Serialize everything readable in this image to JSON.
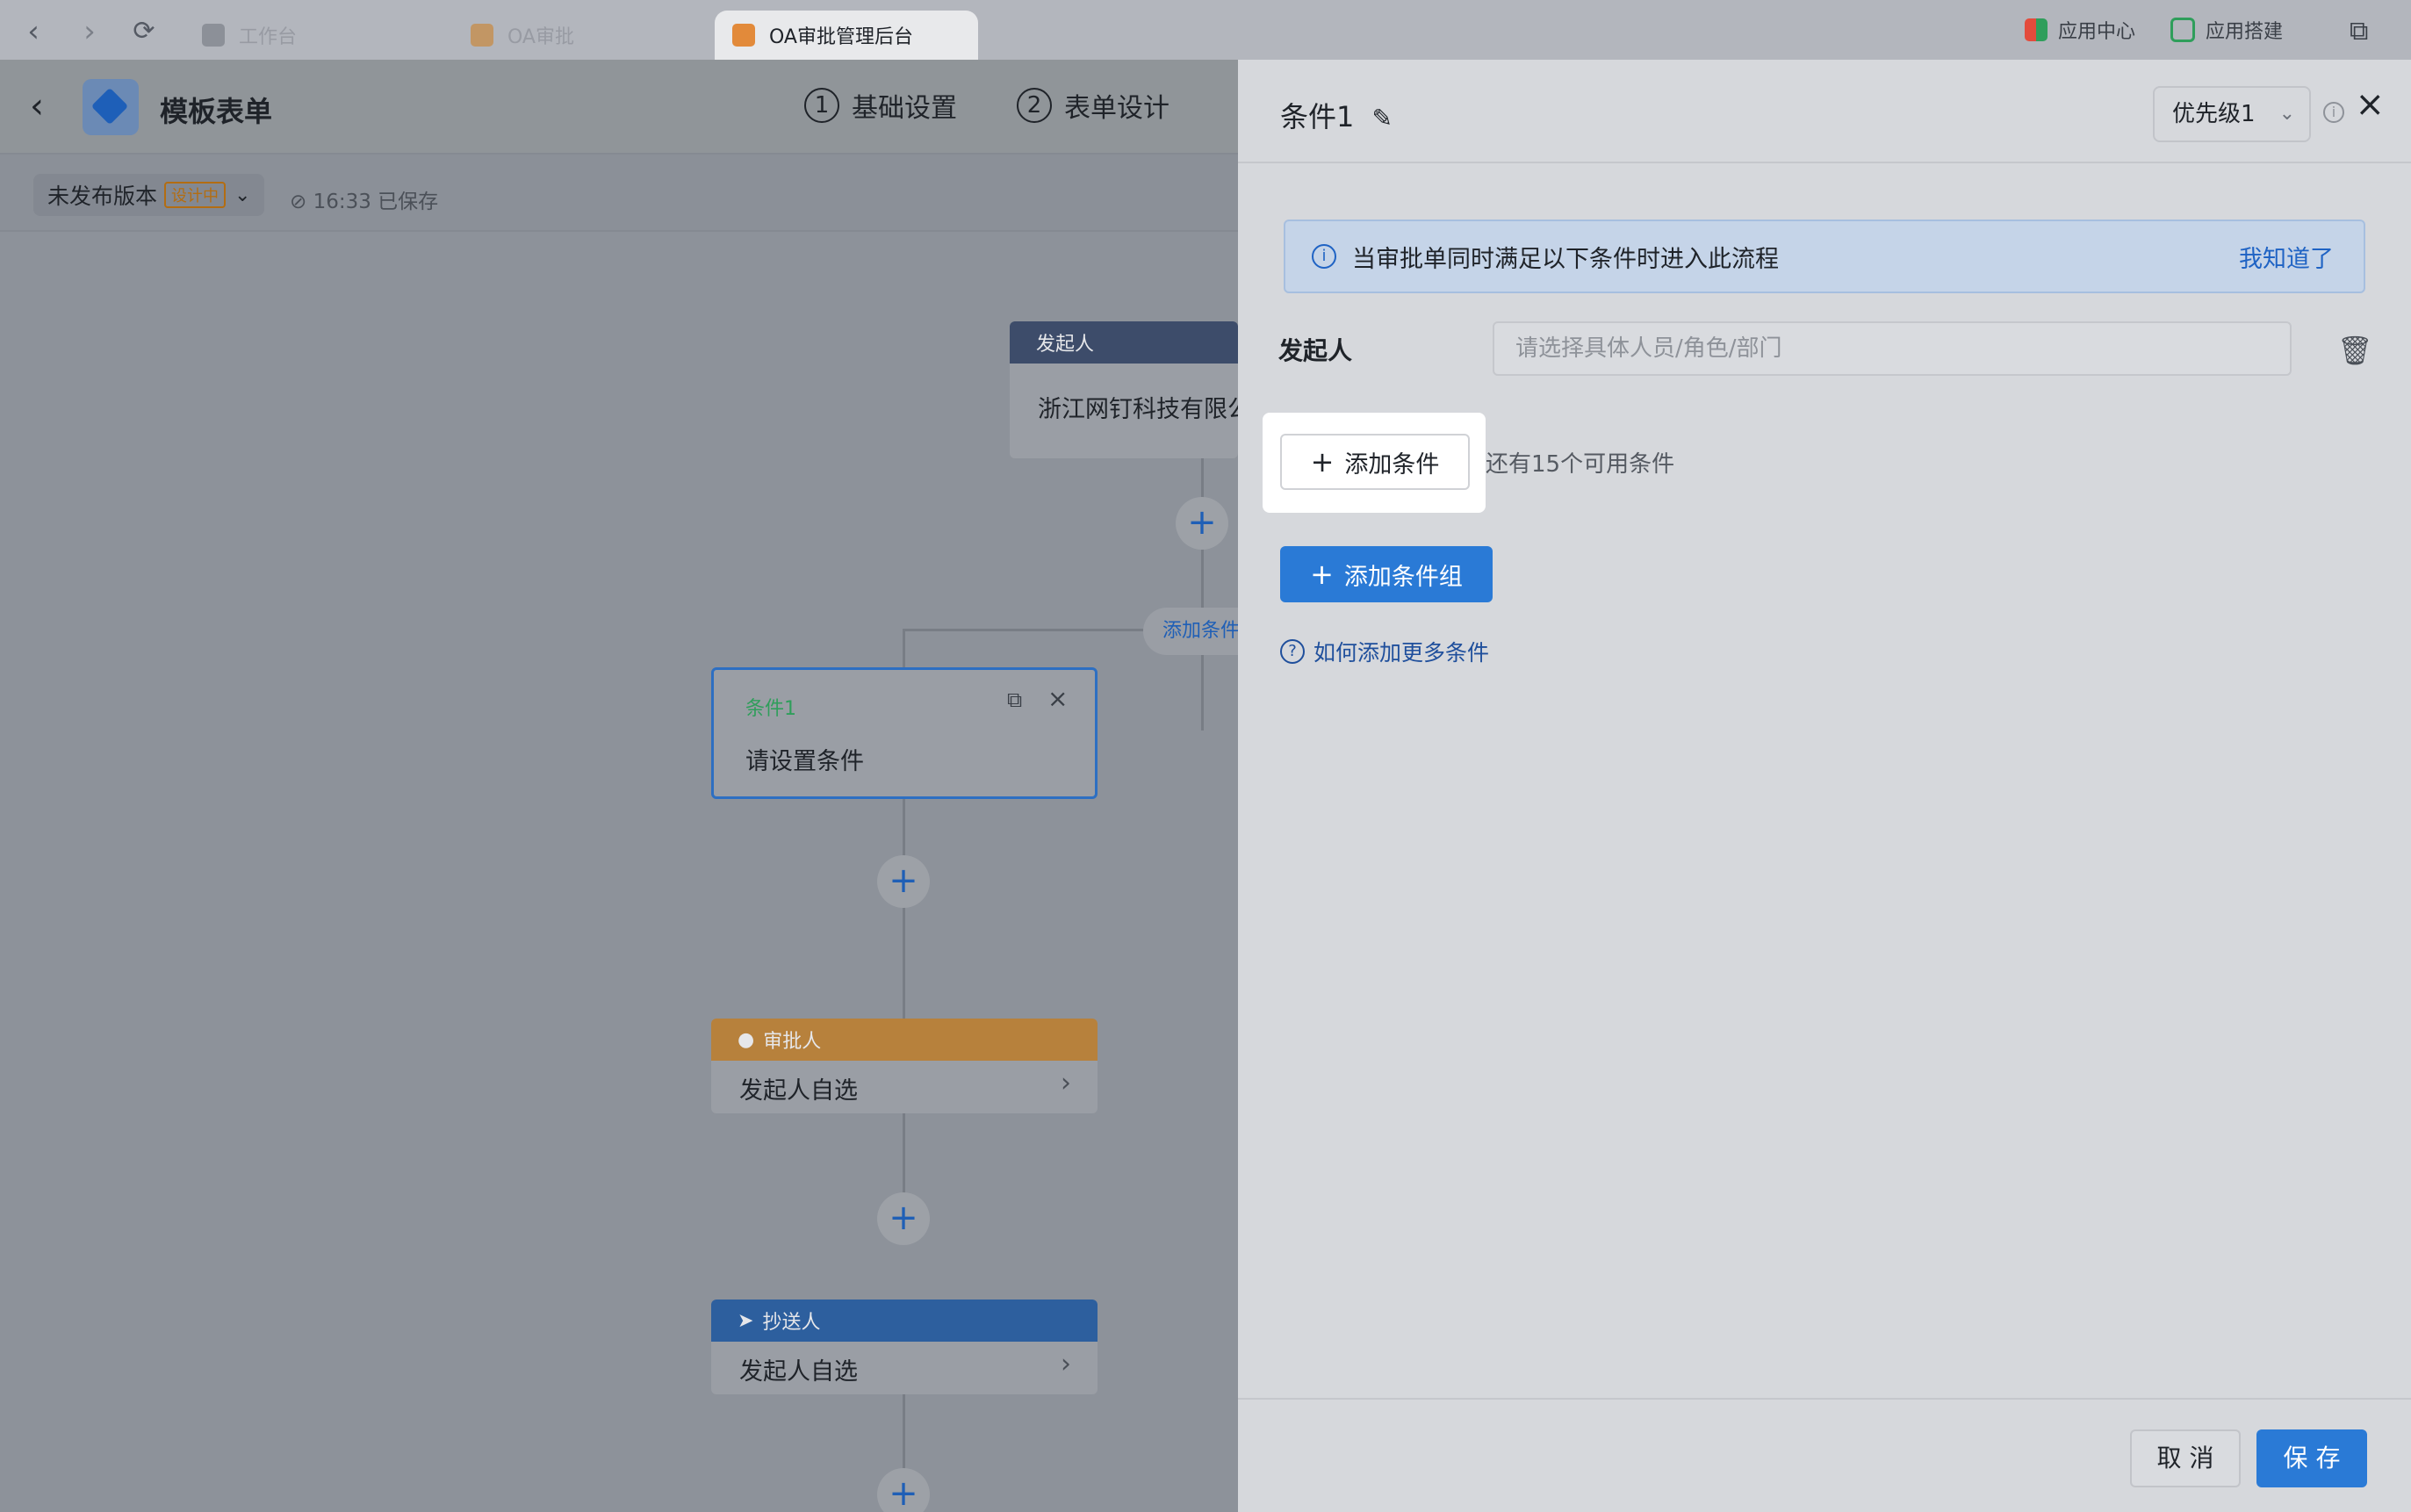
{
  "browser": {
    "tabs": [
      {
        "label": "工作台",
        "active": false
      },
      {
        "label": "OA审批",
        "active": false
      },
      {
        "label": "OA审批管理后台",
        "active": true
      }
    ],
    "app_center": "应用中心",
    "app_builder": "应用搭建"
  },
  "header": {
    "title": "模板表单",
    "steps": [
      {
        "num": "1",
        "label": "基础设置"
      },
      {
        "num": "2",
        "label": "表单设计"
      }
    ]
  },
  "subbar": {
    "version": "未发布版本",
    "badge": "设计中",
    "saved": "16:33 已保存"
  },
  "flow": {
    "initiator_head": "发起人",
    "initiator_body": "浙江网钉科技有限公",
    "add_condition_link": "添加条件",
    "condition_node_title": "条件1",
    "condition_node_body": "请设置条件",
    "approver_head": "审批人",
    "approver_body": "发起人自选",
    "cc_head": "抄送人",
    "cc_body": "发起人自选"
  },
  "drawer": {
    "title": "条件1",
    "priority": "优先级1",
    "info": "当审批单同时满足以下条件时进入此流程",
    "info_ok": "我知道了",
    "field_label": "发起人",
    "field_placeholder": "请选择具体人员/角色/部门",
    "add_condition": "添加条件",
    "remaining": "还有15个可用条件",
    "add_group": "添加条件组",
    "help": "如何添加更多条件",
    "cancel": "取 消",
    "save": "保 存"
  },
  "colors": {
    "primary": "#2a7ad6",
    "approver": "#e09a3a",
    "cc": "#2d6fc2",
    "initiator": "#3d4c6a"
  }
}
